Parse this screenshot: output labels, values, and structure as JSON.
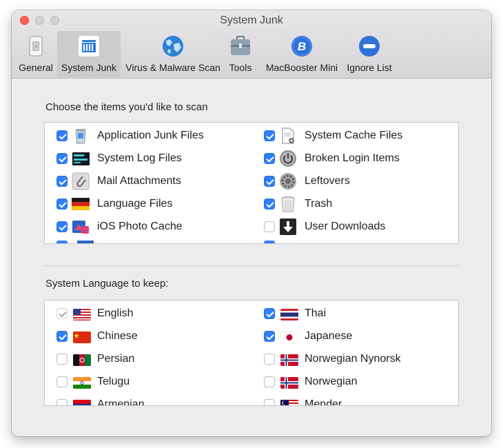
{
  "window": {
    "title": "System Junk"
  },
  "toolbar": {
    "tabs": [
      {
        "label": "General",
        "icon": "general-switch-icon"
      },
      {
        "label": "System Junk",
        "icon": "system-junk-icon",
        "active": true
      },
      {
        "label": "Virus & Malware Scan",
        "icon": "globe-icon"
      },
      {
        "label": "Tools",
        "icon": "toolbox-icon"
      },
      {
        "label": "MacBooster Mini",
        "icon": "macbooster-mini-icon"
      },
      {
        "label": "Ignore List",
        "icon": "ignore-list-icon"
      }
    ]
  },
  "scan": {
    "heading": "Choose the items you'd like to scan",
    "items": [
      {
        "label": "Application Junk Files",
        "checked": true,
        "icon": "trash-bin-icon"
      },
      {
        "label": "System Cache Files",
        "checked": true,
        "icon": "cache-document-icon"
      },
      {
        "label": "System Log Files",
        "checked": true,
        "icon": "console-log-icon"
      },
      {
        "label": "Broken Login Items",
        "checked": true,
        "icon": "power-icon"
      },
      {
        "label": "Mail Attachments",
        "checked": true,
        "icon": "paperclip-icon"
      },
      {
        "label": "Leftovers",
        "checked": true,
        "icon": "gear-icon"
      },
      {
        "label": "Language Files",
        "checked": true,
        "icon": "german-flag-icon"
      },
      {
        "label": "Trash",
        "checked": true,
        "icon": "trash-can-icon"
      },
      {
        "label": "iOS Photo Cache",
        "checked": true,
        "icon": "photo-cache-icon"
      },
      {
        "label": "User Downloads",
        "checked": false,
        "icon": "download-arrow-icon"
      }
    ]
  },
  "languages": {
    "heading": "System Language to keep:",
    "items": [
      {
        "label": "English",
        "state": "disabled-checked",
        "flag": "us-flag"
      },
      {
        "label": "Thai",
        "state": "checked",
        "flag": "thai-flag"
      },
      {
        "label": "Chinese",
        "state": "checked",
        "flag": "china-flag"
      },
      {
        "label": "Japanese",
        "state": "checked",
        "flag": "japan-flag"
      },
      {
        "label": "Persian",
        "state": "unchecked",
        "flag": "afghanistan-flag"
      },
      {
        "label": "Norwegian Nynorsk",
        "state": "unchecked",
        "flag": "norway-flag"
      },
      {
        "label": "Telugu",
        "state": "unchecked",
        "flag": "india-flag"
      },
      {
        "label": "Norwegian",
        "state": "unchecked",
        "flag": "norway-flag"
      },
      {
        "label": "Armenian",
        "state": "unchecked",
        "flag": "armenia-flag"
      },
      {
        "label": "Mender",
        "state": "unchecked",
        "flag": "malaysia-flag"
      }
    ]
  },
  "colors": {
    "checkbox_on": "#2f7ff6",
    "active_tab": "#cdcbcd",
    "window_bg": "#ececec"
  }
}
